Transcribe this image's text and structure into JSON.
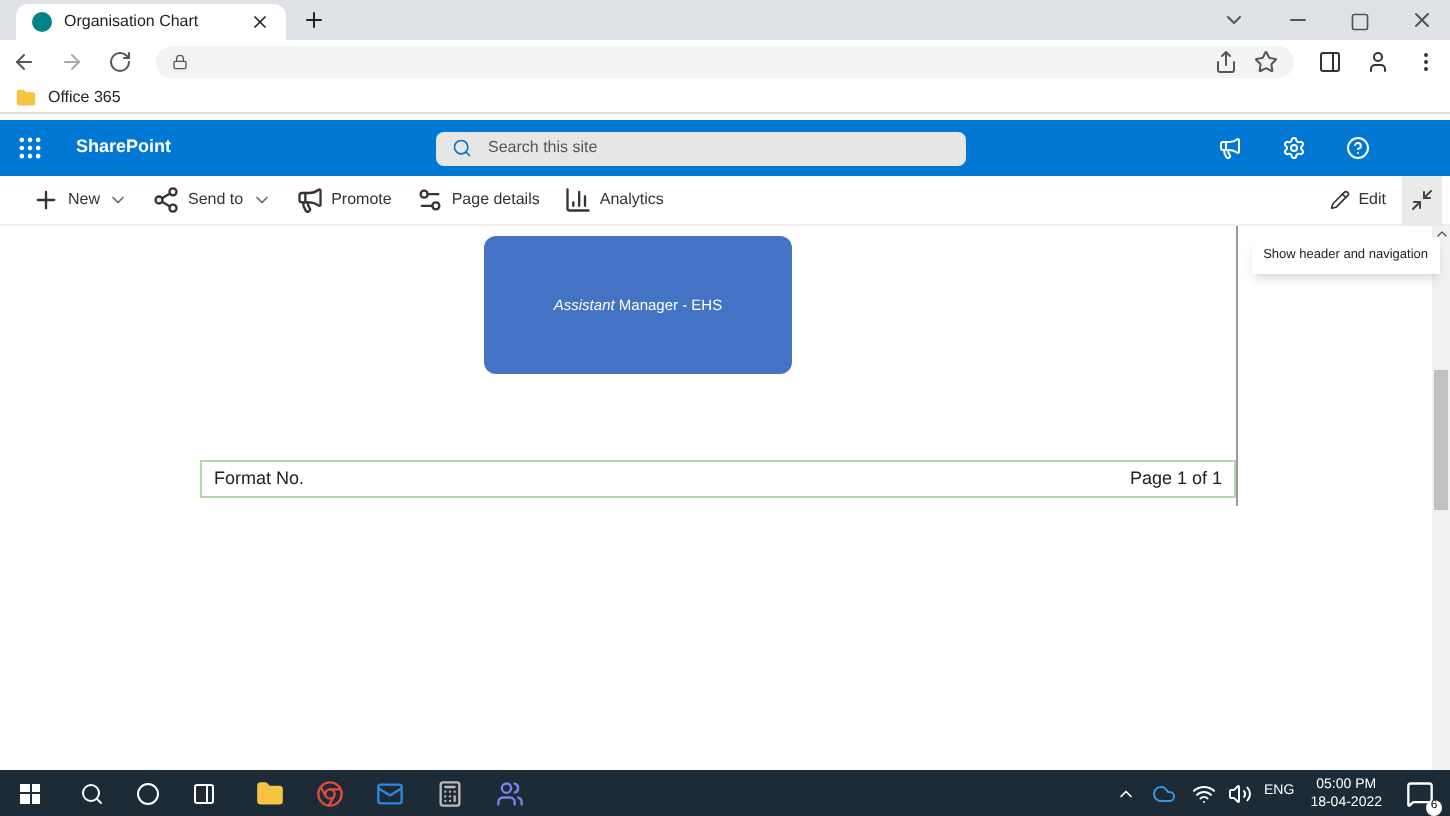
{
  "browser": {
    "tab": {
      "title": "Organisation Chart"
    },
    "bookmarks": [
      {
        "label": "Office 365"
      }
    ]
  },
  "suite_bar": {
    "app_name": "SharePoint",
    "search": {
      "placeholder": "Search this site"
    }
  },
  "command_bar": {
    "items": [
      {
        "label": "New",
        "kind": "new",
        "dropdown": true
      },
      {
        "label": "Send to",
        "kind": "share",
        "dropdown": true
      },
      {
        "label": "Promote",
        "kind": "promote",
        "dropdown": false
      },
      {
        "label": "Page details",
        "kind": "details",
        "dropdown": false
      },
      {
        "label": "Analytics",
        "kind": "analytics",
        "dropdown": false
      }
    ],
    "edit": "Edit"
  },
  "tooltip": "Show header and navigation",
  "document": {
    "chart_box": "*Assistant* Manager - EHS",
    "footer": {
      "format": "Format No.",
      "page": "Page 1 of 1"
    }
  },
  "taskbar": {
    "language": "ENG",
    "time": "05:00 PM",
    "date": "18-04-2022",
    "notifications": "6"
  }
}
